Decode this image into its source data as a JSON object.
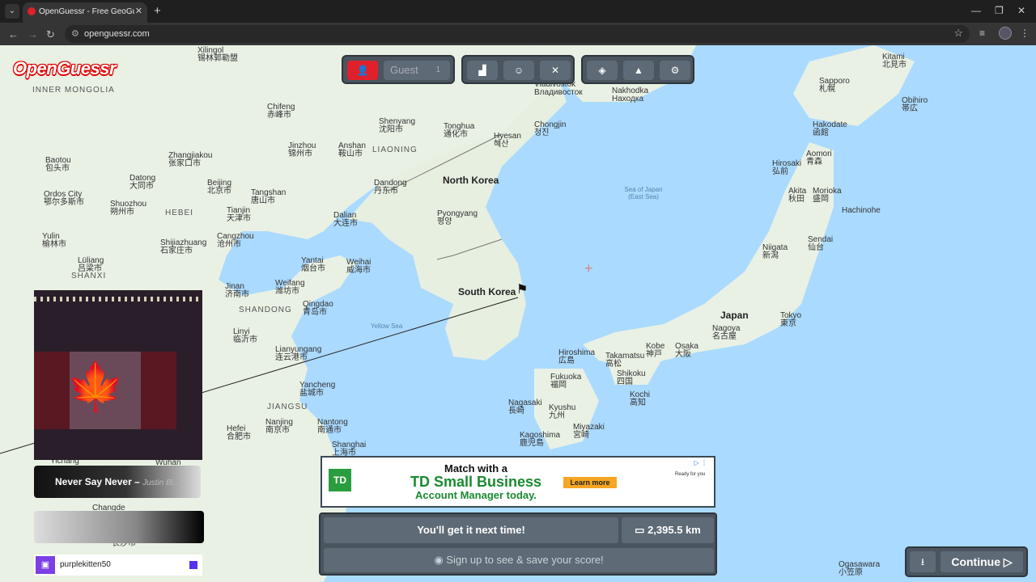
{
  "browser": {
    "tab_title": "OpenGuessr - Free GeoGuessr A",
    "tab_close": "✕",
    "new_tab": "+",
    "url": "openguessr.com",
    "win_min": "—",
    "win_restore": "❐",
    "win_close": "✕"
  },
  "logo": "OpenGuessr",
  "toolbar": {
    "guest_label": "Guest",
    "guest_count": "1"
  },
  "map": {
    "countries": [
      "North Korea",
      "South Korea",
      "Japan"
    ],
    "regions": [
      "INNER MONGOLIA",
      "LIAONING",
      "HEBEI",
      "SHANXI",
      "SHANDONG",
      "JIANGSU"
    ],
    "seas": [
      "Sea of Japan (East Sea)",
      "Yellow Sea"
    ],
    "cities": [
      {
        "name": "Xilingol",
        "sub": "锡林郭勒盟"
      },
      {
        "name": "Chifeng",
        "sub": "赤峰市"
      },
      {
        "name": "Shenyang",
        "sub": "沈阳市"
      },
      {
        "name": "Jinzhou",
        "sub": "锦州市"
      },
      {
        "name": "Anshan",
        "sub": "鞍山市"
      },
      {
        "name": "Baotou",
        "sub": "包头市"
      },
      {
        "name": "Zhangjiakou",
        "sub": "张家口市"
      },
      {
        "name": "Datong",
        "sub": "大同市"
      },
      {
        "name": "Beijing",
        "sub": "北京市"
      },
      {
        "name": "Tangshan",
        "sub": "唐山市"
      },
      {
        "name": "Ordos City",
        "sub": "鄂尔多斯市"
      },
      {
        "name": "Shuozhou",
        "sub": "朔州市"
      },
      {
        "name": "Tianjin",
        "sub": "天津市"
      },
      {
        "name": "Dalian",
        "sub": "大连市"
      },
      {
        "name": "Dandong",
        "sub": "丹东市"
      },
      {
        "name": "Pyongyang",
        "sub": "평양"
      },
      {
        "name": "Yulin",
        "sub": "榆林市"
      },
      {
        "name": "Shijiazhuang",
        "sub": "石家庄市"
      },
      {
        "name": "Cangzhou",
        "sub": "沧州市"
      },
      {
        "name": "Yantai",
        "sub": "烟台市"
      },
      {
        "name": "Weihai",
        "sub": "威海市"
      },
      {
        "name": "Lüliang",
        "sub": "吕梁市"
      },
      {
        "name": "Jinan",
        "sub": "济南市"
      },
      {
        "name": "Weifang",
        "sub": "潍坊市"
      },
      {
        "name": "Qingdao",
        "sub": "青岛市"
      },
      {
        "name": "Linyi",
        "sub": "临沂市"
      },
      {
        "name": "Lianyungang",
        "sub": "连云港市"
      },
      {
        "name": "Yancheng",
        "sub": "盐城市"
      },
      {
        "name": "Hefei",
        "sub": "合肥市"
      },
      {
        "name": "Nanjing",
        "sub": "南京市"
      },
      {
        "name": "Nantong",
        "sub": "南通市"
      },
      {
        "name": "Shanghai",
        "sub": "上海市"
      },
      {
        "name": "Wuhan",
        "sub": "武汉市"
      },
      {
        "name": "Changde",
        "sub": "常德市"
      },
      {
        "name": "Yichang",
        "sub": ""
      },
      {
        "name": "Changsha",
        "sub": "长沙市"
      },
      {
        "name": "Vladivostok",
        "sub": "Владивосток"
      },
      {
        "name": "Nakhodka",
        "sub": "Находка"
      },
      {
        "name": "Chongjin",
        "sub": "청진"
      },
      {
        "name": "Hyesan",
        "sub": "혜산"
      },
      {
        "name": "Tonghua",
        "sub": "通化市"
      },
      {
        "name": "Sapporo",
        "sub": "札幌"
      },
      {
        "name": "Hakodate",
        "sub": "函館"
      },
      {
        "name": "Aomori",
        "sub": "青森"
      },
      {
        "name": "Hirosaki",
        "sub": "弘前"
      },
      {
        "name": "Akita",
        "sub": "秋田"
      },
      {
        "name": "Morioka",
        "sub": "盛岡"
      },
      {
        "name": "Sendai",
        "sub": "仙台"
      },
      {
        "name": "Niigata",
        "sub": "新潟"
      },
      {
        "name": "Tokyo",
        "sub": "東京"
      },
      {
        "name": "Nagoya",
        "sub": "名古屋"
      },
      {
        "name": "Osaka",
        "sub": "大阪"
      },
      {
        "name": "Kobe",
        "sub": "神戸"
      },
      {
        "name": "Hiroshima",
        "sub": "広島"
      },
      {
        "name": "Takamatsu",
        "sub": "高松"
      },
      {
        "name": "Shikoku",
        "sub": "四国"
      },
      {
        "name": "Kochi",
        "sub": "高知"
      },
      {
        "name": "Fukuoka",
        "sub": "福岡"
      },
      {
        "name": "Kyushu",
        "sub": "九州"
      },
      {
        "name": "Nagasaki",
        "sub": "長崎"
      },
      {
        "name": "Miyazaki",
        "sub": "宮崎"
      },
      {
        "name": "Kagoshima",
        "sub": "鹿児島"
      },
      {
        "name": "Kitami",
        "sub": "北見市"
      },
      {
        "name": "Obihiro",
        "sub": "帯広"
      },
      {
        "name": "Hachinohe",
        "sub": ""
      },
      {
        "name": "Ogasawara",
        "sub": "小笠原"
      }
    ]
  },
  "webcam": {
    "song_title": "Never Say Never",
    "song_artist": "Justin Bi..."
  },
  "twitch": {
    "username": "purplekitten50"
  },
  "ad": {
    "line1": "Match with a",
    "line2": "TD Small Business",
    "line3": "Account Manager today.",
    "cta": "Learn more",
    "logo_text": "TD",
    "ready": "Ready for you"
  },
  "result": {
    "message": "You'll get it next time!",
    "distance": "2,395.5 km",
    "signup": "Sign up to see & save your score!"
  },
  "continue": {
    "label": "Continue"
  },
  "colors": {
    "accent_red": "#e0202a",
    "panel": "#4a5560",
    "button": "#5e6a75",
    "water": "#aadaff",
    "land": "#e9f1e4"
  },
  "icons": [
    "add-user-icon",
    "leaderboard-icon",
    "party-icon",
    "battle-icon",
    "layers-icon",
    "graduation-icon",
    "settings-icon",
    "ruler-icon",
    "user-circle-icon",
    "download-icon",
    "play-icon",
    "flag-marker-icon",
    "crosshair-icon"
  ]
}
